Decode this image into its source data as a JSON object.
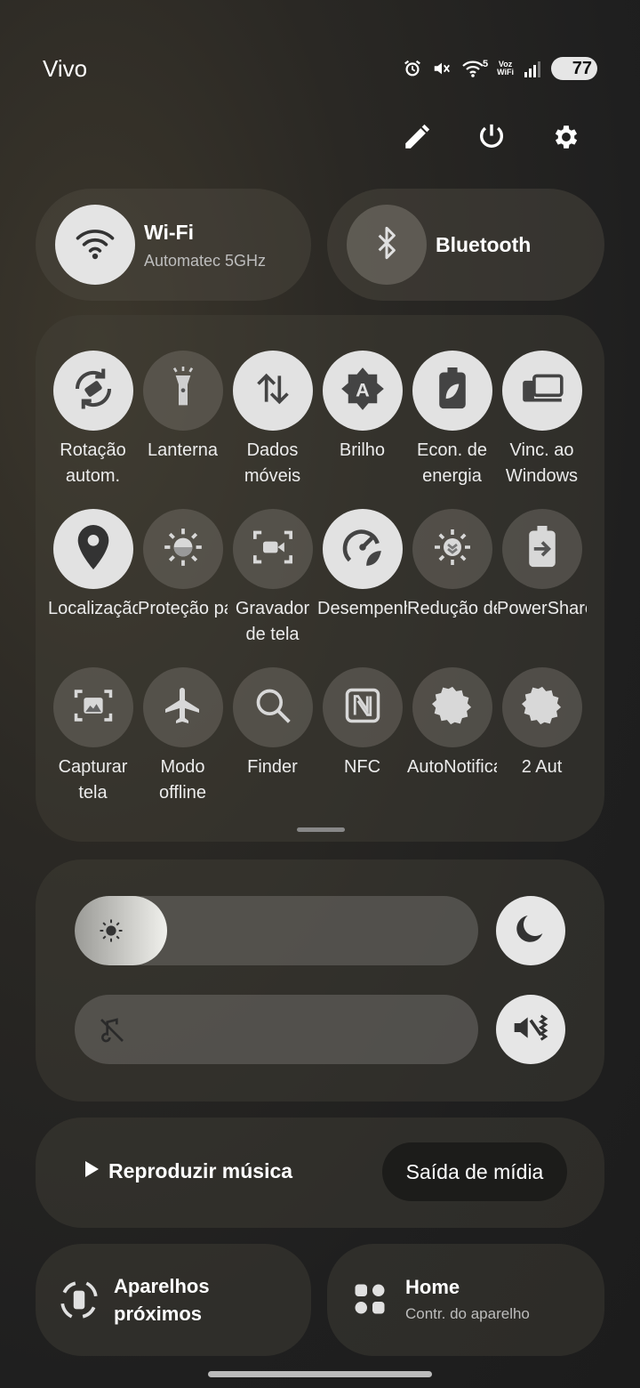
{
  "status_bar": {
    "carrier": "Vivo",
    "battery": "77",
    "net_gen": "5",
    "voz_top": "Voz",
    "voz_bottom": "WiFi"
  },
  "top_actions": [
    "edit-icon",
    "power-icon",
    "settings-icon"
  ],
  "wifi": {
    "title": "Wi-Fi",
    "subtitle": "Automatec 5GHz",
    "on": true
  },
  "bluetooth": {
    "title": "Bluetooth",
    "on": false
  },
  "tiles": [
    {
      "l1": "Rotação",
      "l2": "autom.",
      "on": true,
      "icon": "auto-rotate-icon"
    },
    {
      "l1": "Lanterna",
      "l2": "",
      "on": false,
      "icon": "flashlight-icon"
    },
    {
      "l1": "Dados",
      "l2": "móveis",
      "on": true,
      "icon": "mobile-data-icon"
    },
    {
      "l1": "Brilho",
      "l2": "",
      "on": true,
      "icon": "auto-brightness-icon"
    },
    {
      "l1": "Econ. de",
      "l2": "energia",
      "on": true,
      "icon": "power-saving-icon"
    },
    {
      "l1": "Vinc. ao",
      "l2": "Windows",
      "on": true,
      "icon": "link-windows-icon"
    },
    {
      "l1": "Localização",
      "l2": "",
      "on": true,
      "icon": "location-icon"
    },
    {
      "l1": "Proteção para os olhos",
      "l2": "",
      "on": false,
      "icon": "eye-comfort-icon"
    },
    {
      "l1": "Gravador",
      "l2": "de tela",
      "on": false,
      "icon": "screen-recorder-icon"
    },
    {
      "l1": "Desempenho",
      "l2": "",
      "on": true,
      "icon": "performance-icon"
    },
    {
      "l1": "Redução de brilho",
      "l2": "",
      "on": false,
      "icon": "extra-dim-icon"
    },
    {
      "l1": "PowerShare",
      "l2": "",
      "on": false,
      "icon": "powershare-icon"
    },
    {
      "l1": "Capturar",
      "l2": "tela",
      "on": false,
      "icon": "screenshot-icon"
    },
    {
      "l1": "Modo",
      "l2": "offline",
      "on": false,
      "icon": "airplane-icon"
    },
    {
      "l1": "Finder",
      "l2": "",
      "on": false,
      "icon": "search-icon"
    },
    {
      "l1": "NFC",
      "l2": "",
      "on": false,
      "icon": "nfc-icon"
    },
    {
      "l1": "AutoNotification",
      "l2": "",
      "on": false,
      "icon": "gear-icon"
    },
    {
      "l1": "2 Aut",
      "l2": "",
      "on": false,
      "icon": "gear-icon"
    }
  ],
  "brightness": {
    "level_percent": 23
  },
  "volume": {
    "muted": true
  },
  "media": {
    "play_label": "Reproduzir música",
    "output_label": "Saída de mídia"
  },
  "nearby": {
    "title_1": "Aparelhos",
    "title_2": "próximos"
  },
  "home": {
    "title": "Home",
    "subtitle": "Contr. do aparelho"
  }
}
